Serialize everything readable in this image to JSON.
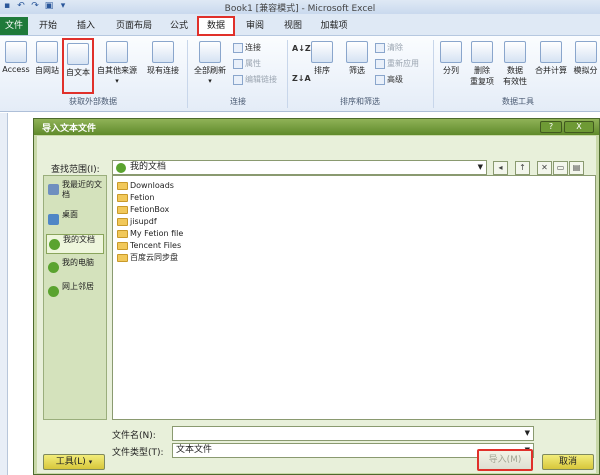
{
  "window": {
    "title": "Book1 [兼容模式] - Microsoft Excel"
  },
  "tabs": [
    {
      "label": "文件"
    },
    {
      "label": "开始"
    },
    {
      "label": "插入"
    },
    {
      "label": "页面布局"
    },
    {
      "label": "公式"
    },
    {
      "label": "数据"
    },
    {
      "label": "审阅"
    },
    {
      "label": "视图"
    },
    {
      "label": "加载项"
    }
  ],
  "ribbon": {
    "external": {
      "access": "Access",
      "web": "自网站",
      "text": "自文本",
      "other": "自其他来源",
      "existing": "现有连接",
      "group_label": "获取外部数据"
    },
    "connections": {
      "refresh_all": "全部刷新",
      "connections": "连接",
      "properties": "属性",
      "edit_links": "编辑链接",
      "group_label": "连接"
    },
    "sort_filter": {
      "sort": "排序",
      "filter": "筛选",
      "clear": "清除",
      "reapply": "重新应用",
      "advanced": "高级",
      "az": "A↓Z",
      "za": "Z↓A",
      "group_label": "排序和筛选"
    },
    "data_tools": {
      "text_to_columns": "分列",
      "remove_dup_1": "删除",
      "remove_dup_2": "重复项",
      "validation_1": "数据",
      "validation_2": "有效性",
      "consolidate": "合并计算",
      "whatif": "模拟分",
      "group_label": "数据工具"
    }
  },
  "dialog": {
    "title": "导入文本文件",
    "help": "?",
    "close": "X",
    "lookin_label": "查找范围(I):",
    "lookin_value": "我的文档",
    "places": [
      {
        "label": "我最近的文档",
        "icon": "recent-docs-icon"
      },
      {
        "label": "桌面",
        "icon": "desktop-icon"
      },
      {
        "label": "我的文档",
        "icon": "my-documents-icon"
      },
      {
        "label": "我的电脑",
        "icon": "my-computer-icon"
      },
      {
        "label": "网上邻居",
        "icon": "network-places-icon"
      }
    ],
    "files": [
      "Downloads",
      "Fetion",
      "FetionBox",
      "jisupdf",
      "My Fetion file",
      "Tencent Files",
      "百度云同步盘"
    ],
    "filename_label": "文件名(N):",
    "filename_value": "",
    "filetype_label": "文件类型(T):",
    "filetype_value": "文本文件",
    "tools_button": "工具(L)",
    "import_button": "导入(M)",
    "cancel_button": "取消"
  }
}
